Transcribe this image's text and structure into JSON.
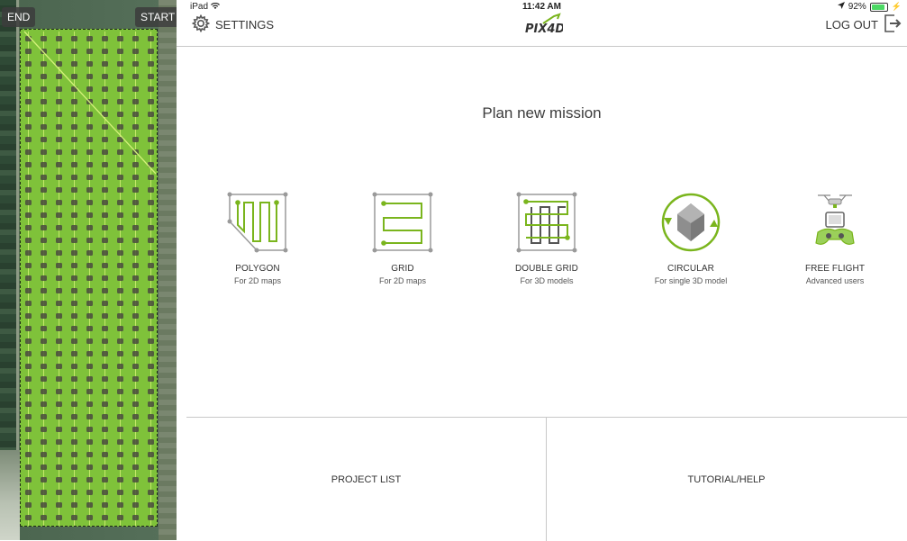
{
  "map": {
    "end_label": "END",
    "start_label": "START"
  },
  "status_bar": {
    "device": "iPad",
    "time": "11:42 AM",
    "battery": "92%",
    "wifi_icon": "wifi-icon",
    "location_icon": "location-arrow-icon",
    "battery_icon": "battery-icon"
  },
  "nav": {
    "settings_label": "SETTINGS",
    "logout_label": "LOG OUT",
    "logo_text": "PIX4D"
  },
  "main": {
    "title": "Plan new mission",
    "missions": [
      {
        "name": "POLYGON",
        "sub": "For 2D maps",
        "icon": "polygon-icon"
      },
      {
        "name": "GRID",
        "sub": "For 2D maps",
        "icon": "grid-icon"
      },
      {
        "name": "DOUBLE GRID",
        "sub": "For 3D models",
        "icon": "double-grid-icon"
      },
      {
        "name": "CIRCULAR",
        "sub": "For single 3D model",
        "icon": "circular-icon"
      },
      {
        "name": "FREE FLIGHT",
        "sub": "Advanced users",
        "icon": "free-flight-icon"
      }
    ]
  },
  "bottom": {
    "project_list": "PROJECT LIST",
    "tutorial": "TUTORIAL/HELP"
  },
  "colors": {
    "accent_green": "#7ab51d",
    "field_green": "#7fc23a",
    "icon_gray": "#9a9a9a"
  }
}
